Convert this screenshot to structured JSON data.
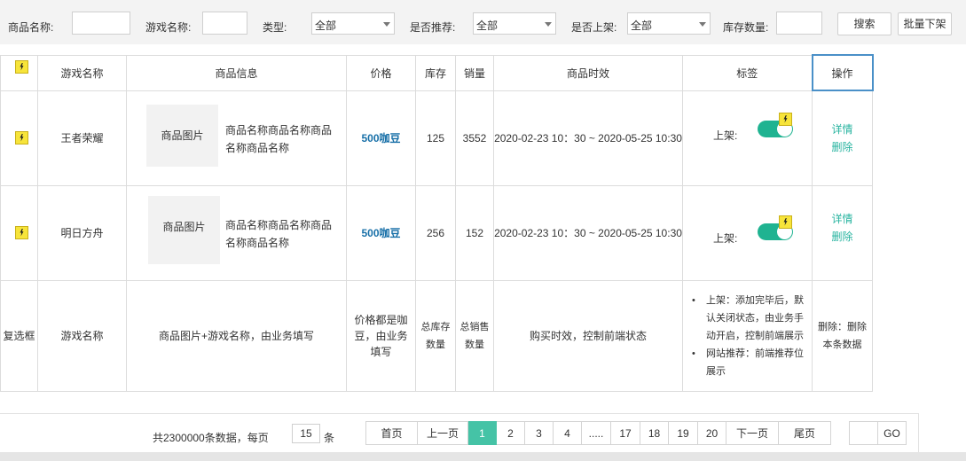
{
  "filters": {
    "product_name_label": "商品名称:",
    "game_name_label": "游戏名称:",
    "type_label": "类型:",
    "type_value": "全部",
    "recommend_label": "是否推荐:",
    "recommend_value": "全部",
    "listed_label": "是否上架:",
    "listed_value": "全部",
    "stock_label": "库存数量:",
    "search_button": "搜索",
    "batch_off_button": "批量下架"
  },
  "table": {
    "headers": {
      "game": "游戏名称",
      "product": "商品信息",
      "price": "价格",
      "stock": "库存",
      "sales": "销量",
      "validity": "商品时效",
      "tags": "标签",
      "operation": "操作"
    },
    "rows": [
      {
        "game": "王者荣耀",
        "image_label": "商品图片",
        "product_name": "商品名称商品名称商品名称商品名称",
        "price": "500咖豆",
        "stock": "125",
        "sales": "3552",
        "validity": "2020-02-23 10：30 ~ 2020-05-25 10:30",
        "tag_label": "上架:",
        "detail_link": "详情",
        "delete_link": "删除"
      },
      {
        "game": "明日方舟",
        "image_label": "商品图片",
        "product_name": "商品名称商品名称商品名称商品名称",
        "price": "500咖豆",
        "stock": "256",
        "sales": "152",
        "validity": "2020-02-23 10：30 ~ 2020-05-25 10:30",
        "tag_label": "上架:",
        "detail_link": "详情",
        "delete_link": "删除"
      }
    ],
    "notes": {
      "checkbox": "复选框",
      "game": "游戏名称",
      "product": "商品图片+游戏名称，由业务填写",
      "price": "价格都是咖豆，由业务填写",
      "stock": "总库存数量",
      "sales": "总销售数量",
      "validity": "购买时效，控制前端状态",
      "tags_item1": "上架：添加完毕后，默认关闭状态，由业务手动开启，控制前端展示",
      "tags_item2": "网站推荐：前端推荐位展示",
      "operation": "删除：删除本条数据"
    }
  },
  "pagination": {
    "total_text": "共2300000条数据，每页",
    "page_size": "15",
    "unit": "条",
    "first": "首页",
    "prev": "上一页",
    "pages": [
      "1",
      "2",
      "3",
      "4",
      ".....",
      "17",
      "18",
      "19",
      "20"
    ],
    "active_page": "1",
    "next": "下一页",
    "last": "尾页",
    "go": "GO"
  },
  "colors": {
    "accent_green": "#45c3a6",
    "price_blue": "#1870a8",
    "link_teal": "#28b4a0",
    "operation_header_border": "#4a90c8"
  }
}
